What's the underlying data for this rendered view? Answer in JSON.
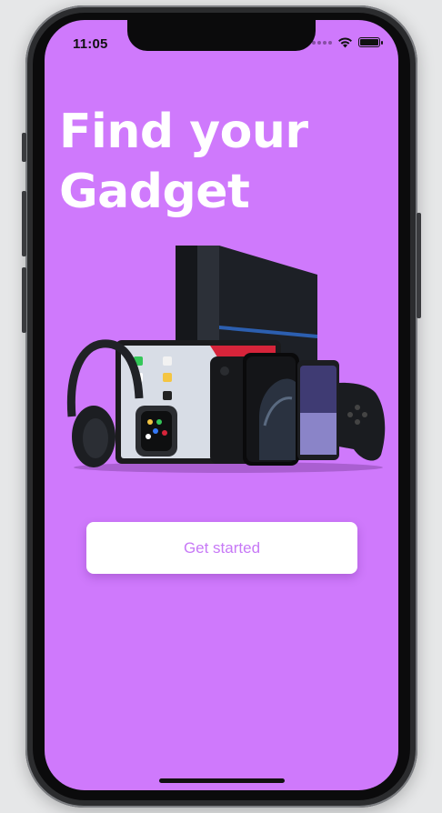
{
  "status_bar": {
    "time": "11:05",
    "icons": [
      "cellular-signal-icon",
      "wifi-icon",
      "battery-icon"
    ]
  },
  "onboarding": {
    "headline_line1": "Find your",
    "headline_line2": "Gadget",
    "hero_image": "gadgets-collage-image",
    "cta_label": "Get started"
  },
  "colors": {
    "background": "#cf79fc",
    "headline": "#ffffff",
    "button_background": "#ffffff",
    "button_text": "#c779f6"
  }
}
